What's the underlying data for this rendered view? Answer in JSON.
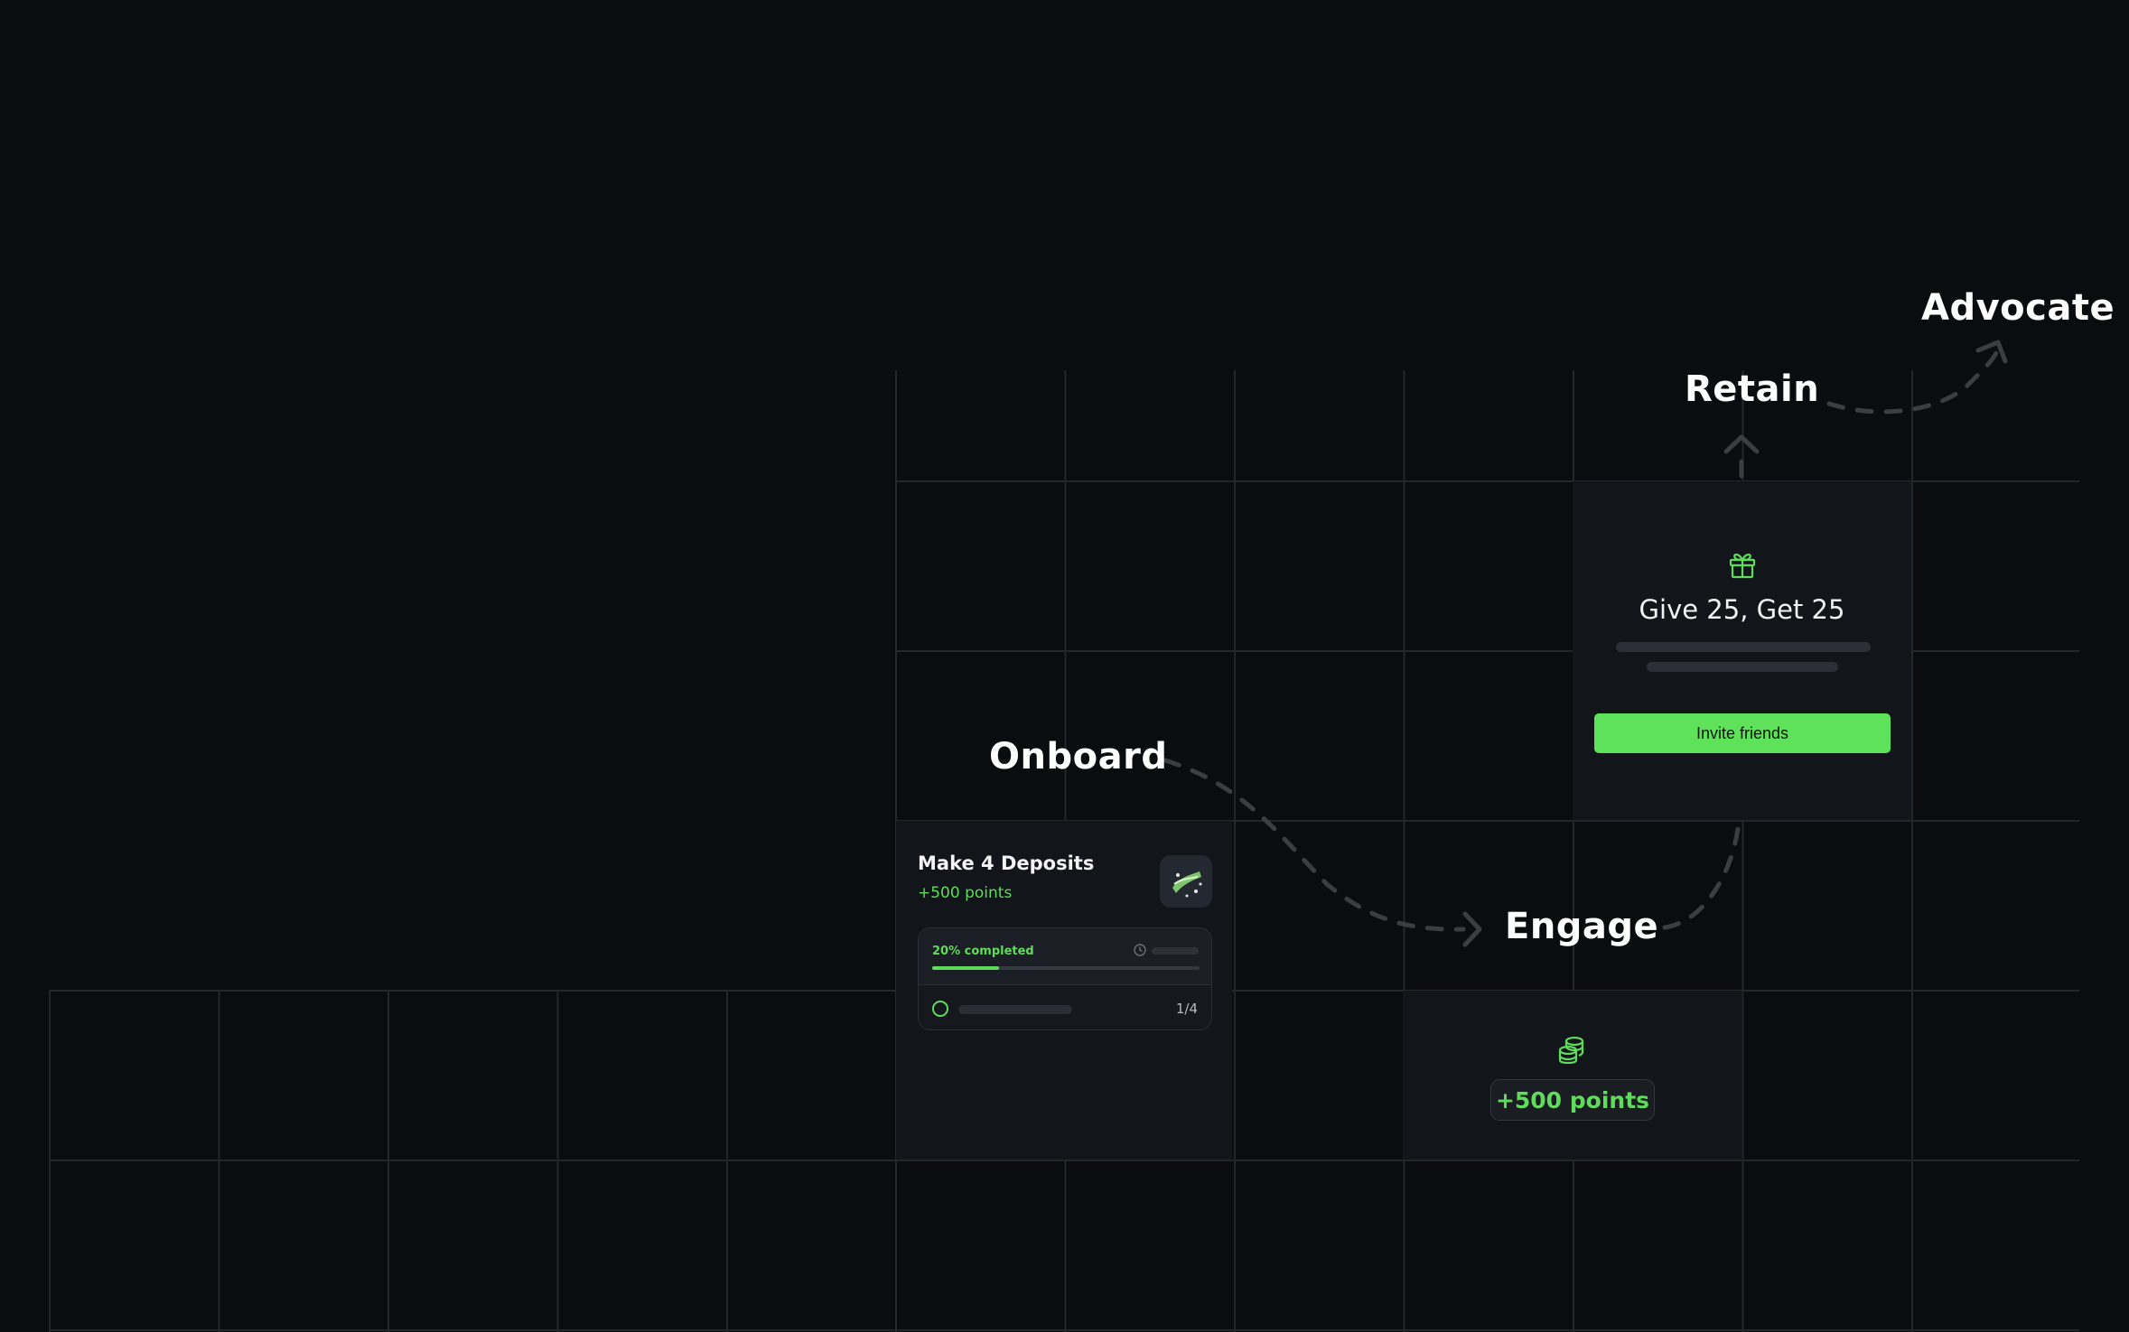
{
  "stages": {
    "onboard": "Onboard",
    "engage": "Engage",
    "retain": "Retain",
    "advocate": "Advocate"
  },
  "deposit_card": {
    "title": "Make 4 Deposits",
    "points": "+500 points",
    "progress_label": "20% completed",
    "progress_fraction": 0.25,
    "step_count": "1/4"
  },
  "give_card": {
    "heading": "Give 25, Get 25",
    "button_label": "Invite friends"
  },
  "points_card": {
    "badge": "+500 points"
  },
  "colors": {
    "accent": "#5fdc5b",
    "background": "#0a0c0f",
    "card": "#12151a"
  },
  "icons": {
    "gift": "gift-icon",
    "coins": "coins-icon",
    "clock": "clock-icon",
    "money": "money-icon"
  }
}
